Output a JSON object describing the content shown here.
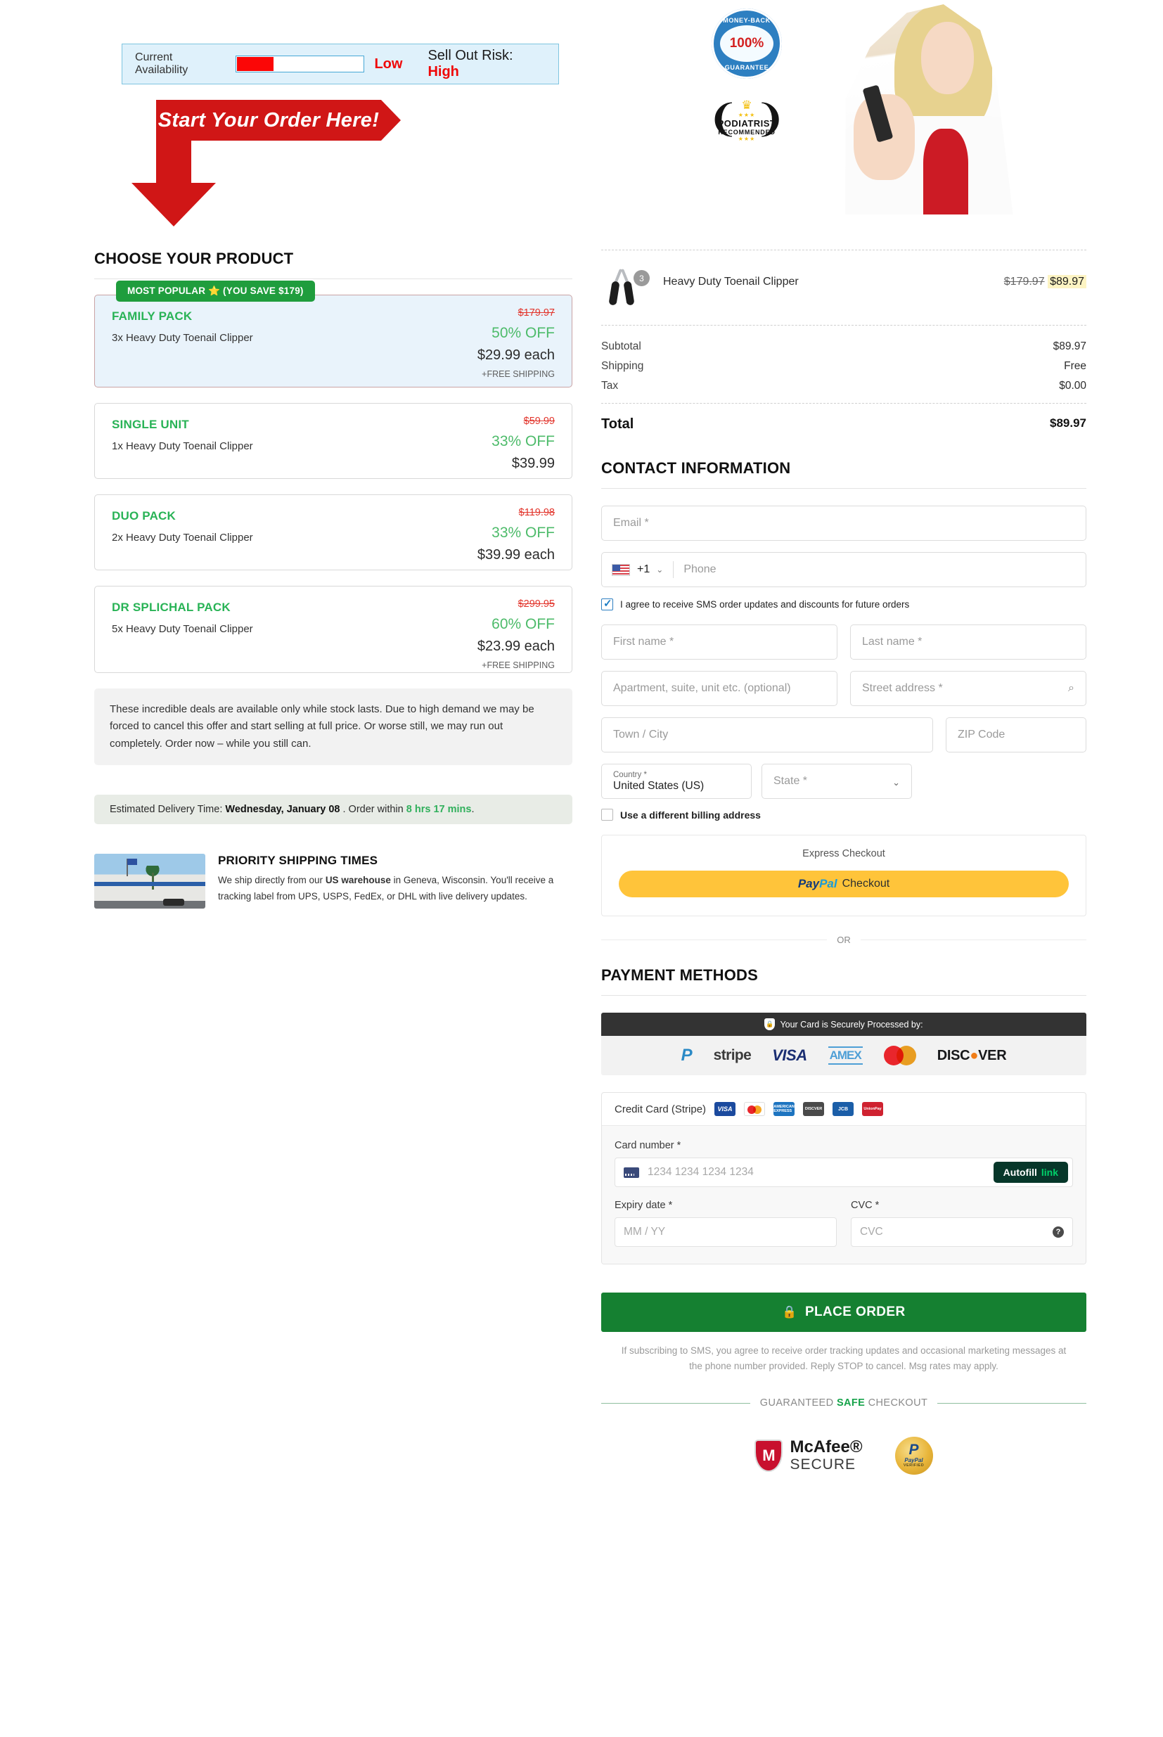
{
  "header": {
    "availability_label": "Current Availability",
    "availability_level": "Low",
    "sellout_label": "Sell Out Risk:",
    "sellout_level": "High",
    "cta_banner": "Start Your Order Here!",
    "badge_money_back_top": "MONEY-BACK",
    "badge_money_back_pct": "100%",
    "badge_money_back_bottom": "GUARANTEE",
    "badge_podiatrist_line1": "PODIATRIST",
    "badge_podiatrist_line2": "RECOMMENDED"
  },
  "left": {
    "section_title": "CHOOSE YOUR PRODUCT",
    "popular_badge": "MOST POPULAR ⭐ (YOU SAVE $179)",
    "products": [
      {
        "name": "FAMILY PACK",
        "desc": "3x Heavy Duty Toenail Clipper",
        "old_price": "$179.97",
        "discount": "50% OFF",
        "price": "$29.99 each",
        "shipping": "+FREE SHIPPING",
        "selected": true
      },
      {
        "name": "SINGLE UNIT",
        "desc": "1x Heavy Duty Toenail Clipper",
        "old_price": "$59.99",
        "discount": "33% OFF",
        "price": "$39.99",
        "shipping": "",
        "selected": false
      },
      {
        "name": "DUO PACK",
        "desc": "2x Heavy Duty Toenail Clipper",
        "old_price": "$119.98",
        "discount": "33% OFF",
        "price": "$39.99 each",
        "shipping": "",
        "selected": false
      },
      {
        "name": "DR SPLICHAL PACK",
        "desc": "5x Heavy Duty Toenail Clipper",
        "old_price": "$299.95",
        "discount": "60% OFF",
        "price": "$23.99 each",
        "shipping": "+FREE SHIPPING",
        "selected": false
      }
    ],
    "scarcity_text": "These incredible deals are available only while stock lasts. Due to high demand we may be forced to cancel this offer and start selling at full price. Or worse still, we may run out completely. Order now – while you still can.",
    "delivery_prefix": "Estimated Delivery Time:",
    "delivery_date": "Wednesday, January 08",
    "delivery_mid": ". Order within",
    "delivery_countdown": "8 hrs 17 mins",
    "delivery_suffix": ".",
    "shipping_title": "PRIORITY SHIPPING TIMES",
    "shipping_line1_a": "We ship directly from our ",
    "shipping_line1_b": "US warehouse",
    "shipping_line1_c": " in Geneva, Wisconsin.",
    "shipping_line2": "You'll receive a tracking label from UPS, USPS, FedEx, or DHL with live delivery updates."
  },
  "summary": {
    "item_qty": "3",
    "item_name": "Heavy Duty Toenail Clipper",
    "item_old_price": "$179.97",
    "item_price": "$89.97",
    "rows": [
      {
        "label": "Subtotal",
        "value": "$89.97"
      },
      {
        "label": "Shipping",
        "value": "Free"
      },
      {
        "label": "Tax",
        "value": "$0.00"
      }
    ],
    "total_label": "Total",
    "total_value": "$89.97"
  },
  "contact": {
    "section_title": "CONTACT INFORMATION",
    "email_placeholder": "Email *",
    "country_code": "+1",
    "phone_placeholder": "Phone",
    "sms_consent": "I agree to receive SMS order updates and discounts for future orders",
    "first_name_placeholder": "First name *",
    "last_name_placeholder": "Last name *",
    "apartment_placeholder": "Apartment, suite, unit etc. (optional)",
    "street_placeholder": "Street address *",
    "city_placeholder": "Town / City",
    "zip_placeholder": "ZIP Code",
    "country_label": "Country *",
    "country_value": "United States (US)",
    "state_placeholder": "State *",
    "billing_checkbox": "Use a different billing address"
  },
  "express": {
    "title": "Express Checkout",
    "paypal_brand_a": "Pay",
    "paypal_brand_b": "Pal",
    "paypal_label": "Checkout",
    "or_label": "OR"
  },
  "payment": {
    "section_title": "PAYMENT METHODS",
    "secure_bar": "Your Card is Securely Processed by:",
    "processors": [
      "PayPal",
      "stripe",
      "VISA",
      "AMEX",
      "Mastercard",
      "DISCOVER"
    ],
    "cc_label": "Credit Card (Stripe)",
    "cc_brands": [
      "VISA",
      "Mastercard",
      "AMERICAN EXPRESS",
      "DISCOVER",
      "JCB",
      "UnionPay"
    ],
    "card_number_label": "Card number *",
    "card_number_placeholder": "1234 1234 1234 1234",
    "autofill_label": "Autofill",
    "autofill_link": "link",
    "expiry_label": "Expiry date *",
    "expiry_placeholder": "MM / YY",
    "cvc_label": "CVC *",
    "cvc_placeholder": "CVC"
  },
  "footer": {
    "place_order": "PLACE ORDER",
    "sms_legal": "If subscribing to SMS, you agree to receive order tracking updates and occasional marketing messages at the phone number provided. Reply STOP to cancel. Msg rates may apply.",
    "safe_pre": "GUARANTEED ",
    "safe_mid": "SAFE",
    "safe_post": " CHECKOUT",
    "mcafee_1": "McAfee®",
    "mcafee_2": "SECURE",
    "paypal_verified_1": "PayPal",
    "paypal_verified_2": "VERIFIED"
  }
}
